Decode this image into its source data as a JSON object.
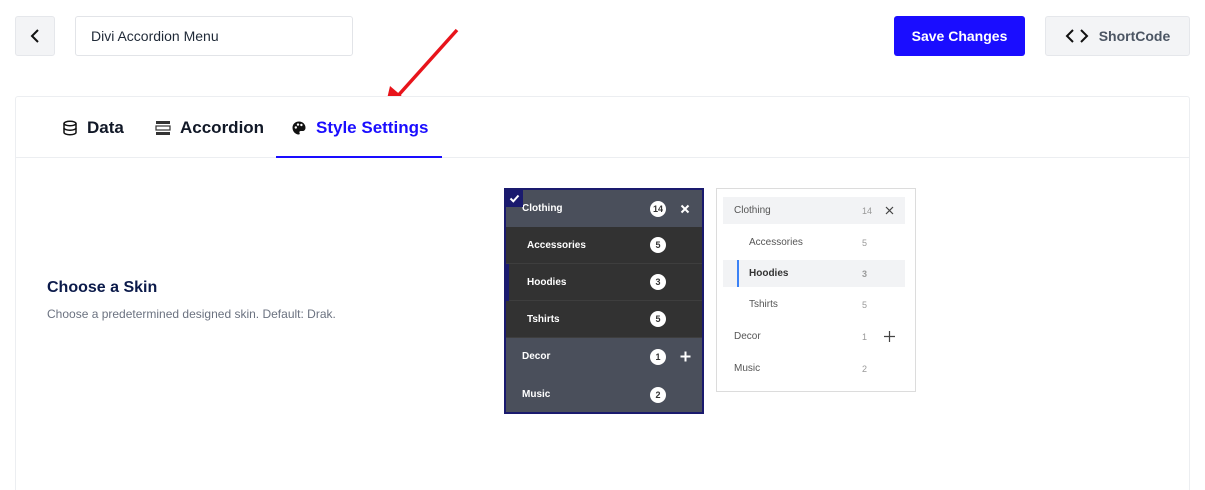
{
  "header": {
    "menu_name_value": "Divi Accordion Menu",
    "save_label": "Save Changes",
    "shortcode_label": "ShortCode"
  },
  "tabs": [
    {
      "label": "Data",
      "icon": "database-icon"
    },
    {
      "label": "Accordion",
      "icon": "accordion-icon"
    },
    {
      "label": "Style Settings",
      "icon": "palette-icon",
      "active": true
    }
  ],
  "skin": {
    "title": "Choose a Skin",
    "description": "Choose a predetermined designed skin. Default: Drak."
  },
  "dark_skin": {
    "selected": true,
    "items": [
      {
        "label": "Clothing",
        "count": "14",
        "icon": "close-icon"
      },
      {
        "label": "Accessories",
        "count": "5"
      },
      {
        "label": "Hoodies",
        "count": "3"
      },
      {
        "label": "Tshirts",
        "count": "5"
      },
      {
        "label": "Decor",
        "count": "1",
        "icon": "plus-icon"
      },
      {
        "label": "Music",
        "count": "2"
      }
    ]
  },
  "light_skin": {
    "items": [
      {
        "label": "Clothing",
        "count": "14",
        "icon": "close-icon"
      },
      {
        "label": "Accessories",
        "count": "5"
      },
      {
        "label": "Hoodies",
        "count": "3"
      },
      {
        "label": "Tshirts",
        "count": "5"
      },
      {
        "label": "Decor",
        "count": "1",
        "icon": "plus-icon"
      },
      {
        "label": "Music",
        "count": "2"
      }
    ]
  },
  "colors": {
    "accent": "#1a0dff",
    "annotation_arrow": "#e8141b",
    "dark_parent": "#4a4f5b",
    "dark_child": "#323232"
  }
}
